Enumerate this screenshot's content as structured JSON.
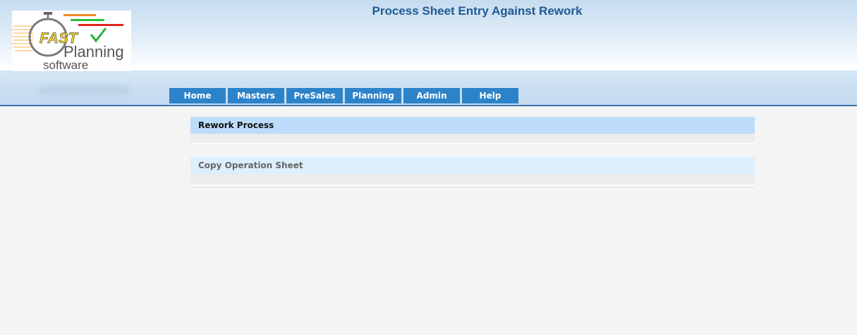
{
  "header": {
    "title": "Process Sheet Entry Against Rework",
    "logo": {
      "line1": "FAST",
      "line2": "Planning",
      "line3": "software"
    }
  },
  "nav": {
    "items": [
      {
        "label": "Home"
      },
      {
        "label": "Masters"
      },
      {
        "label": "PreSales"
      },
      {
        "label": "Planning"
      },
      {
        "label": "Admin"
      },
      {
        "label": "Help"
      }
    ]
  },
  "main": {
    "panels": [
      {
        "label": "Rework Process"
      },
      {
        "label": "Copy Operation Sheet"
      }
    ]
  },
  "colors": {
    "nav_button": "#2d83c9",
    "title": "#1e5a96",
    "panel_active": "#bcdcfa",
    "panel_inactive": "#ddeefc"
  }
}
